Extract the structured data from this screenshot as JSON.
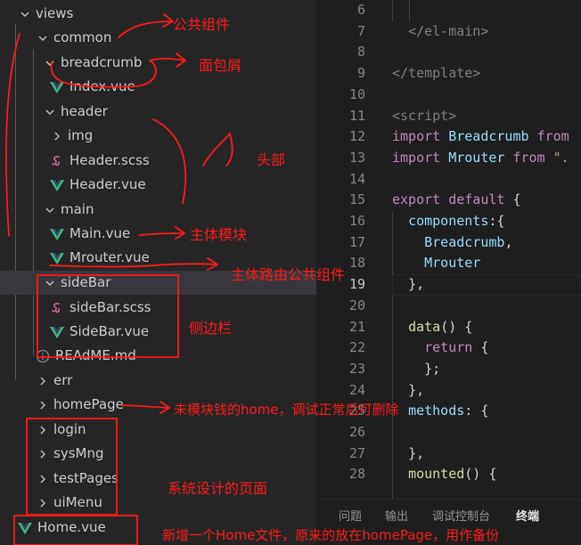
{
  "explorer": {
    "items": [
      {
        "label": "views",
        "type": "folder-open"
      },
      {
        "label": "common",
        "type": "folder-open"
      },
      {
        "label": "breadcrumb",
        "type": "folder-open"
      },
      {
        "label": "Index.vue",
        "type": "vue"
      },
      {
        "label": "header",
        "type": "folder-open"
      },
      {
        "label": "img",
        "type": "folder-closed"
      },
      {
        "label": "Header.scss",
        "type": "scss"
      },
      {
        "label": "Header.vue",
        "type": "vue"
      },
      {
        "label": "main",
        "type": "folder-open"
      },
      {
        "label": "Main.vue",
        "type": "vue"
      },
      {
        "label": "Mrouter.vue",
        "type": "vue"
      },
      {
        "label": "sideBar",
        "type": "folder-open"
      },
      {
        "label": "sideBar.scss",
        "type": "scss"
      },
      {
        "label": "SideBar.vue",
        "type": "vue"
      },
      {
        "label": "REAdME.md",
        "type": "info"
      },
      {
        "label": "err",
        "type": "folder-closed"
      },
      {
        "label": "homePage",
        "type": "folder-closed"
      },
      {
        "label": "login",
        "type": "folder-closed"
      },
      {
        "label": "sysMng",
        "type": "folder-closed"
      },
      {
        "label": "testPages",
        "type": "folder-closed"
      },
      {
        "label": "uiMenu",
        "type": "folder-closed"
      },
      {
        "label": "Home.vue",
        "type": "vue"
      }
    ]
  },
  "editor": {
    "line_numbers": [
      "6",
      "7",
      "8",
      "9",
      "10",
      "11",
      "12",
      "13",
      "14",
      "15",
      "16",
      "17",
      "18",
      "19",
      "20",
      "21",
      "22",
      "23",
      "24",
      "25",
      "26",
      "27",
      "28"
    ],
    "active_line": "19",
    "lines": [
      {
        "indent": "  ",
        "tokens": [
          {
            "t": "",
            "c": ""
          }
        ]
      },
      {
        "indent": "  ",
        "tokens": [
          {
            "t": "</el-main>",
            "c": "tg"
          }
        ]
      },
      {
        "indent": "",
        "tokens": [
          {
            "t": "",
            "c": ""
          }
        ]
      },
      {
        "indent": "",
        "tokens": [
          {
            "t": "</template>",
            "c": "tg"
          }
        ]
      },
      {
        "indent": "",
        "tokens": [
          {
            "t": "",
            "c": ""
          }
        ]
      },
      {
        "indent": "",
        "tokens": [
          {
            "t": "<script>",
            "c": "tg"
          }
        ]
      },
      {
        "indent": "",
        "tokens": [
          {
            "t": "import",
            "c": "kw2"
          },
          {
            "t": " Breadcrumb ",
            "c": "id"
          },
          {
            "t": "from",
            "c": "kw2"
          }
        ]
      },
      {
        "indent": "",
        "tokens": [
          {
            "t": "import",
            "c": "kw2"
          },
          {
            "t": " Mrouter ",
            "c": "id"
          },
          {
            "t": "from",
            "c": "kw2"
          },
          {
            "t": " \".",
            "c": "str"
          }
        ]
      },
      {
        "indent": "",
        "tokens": [
          {
            "t": "",
            "c": ""
          }
        ]
      },
      {
        "indent": "",
        "tokens": [
          {
            "t": "export",
            "c": "kw2"
          },
          {
            "t": " ",
            "c": ""
          },
          {
            "t": "default",
            "c": "kw2"
          },
          {
            "t": " {",
            "c": ""
          }
        ]
      },
      {
        "indent": "  ",
        "tokens": [
          {
            "t": "components",
            "c": "id"
          },
          {
            "t": ":{",
            "c": ""
          }
        ]
      },
      {
        "indent": "    ",
        "tokens": [
          {
            "t": "Breadcrumb",
            "c": "id"
          },
          {
            "t": ",",
            "c": ""
          }
        ]
      },
      {
        "indent": "    ",
        "tokens": [
          {
            "t": "Mrouter",
            "c": "id"
          }
        ]
      },
      {
        "indent": "  ",
        "tokens": [
          {
            "t": "},",
            "c": ""
          }
        ]
      },
      {
        "indent": "",
        "tokens": [
          {
            "t": "",
            "c": ""
          }
        ]
      },
      {
        "indent": "  ",
        "tokens": [
          {
            "t": "data",
            "c": "fn"
          },
          {
            "t": "() {",
            "c": ""
          }
        ]
      },
      {
        "indent": "    ",
        "tokens": [
          {
            "t": "return",
            "c": "kw2"
          },
          {
            "t": " {",
            "c": ""
          }
        ]
      },
      {
        "indent": "    ",
        "tokens": [
          {
            "t": "};",
            "c": ""
          }
        ]
      },
      {
        "indent": "  ",
        "tokens": [
          {
            "t": "},",
            "c": ""
          }
        ]
      },
      {
        "indent": "  ",
        "tokens": [
          {
            "t": "methods",
            "c": "id"
          },
          {
            "t": ": {",
            "c": ""
          }
        ]
      },
      {
        "indent": "",
        "tokens": [
          {
            "t": "",
            "c": ""
          }
        ]
      },
      {
        "indent": "  ",
        "tokens": [
          {
            "t": "},",
            "c": ""
          }
        ]
      },
      {
        "indent": "  ",
        "tokens": [
          {
            "t": "mounted",
            "c": "fn"
          },
          {
            "t": "() {",
            "c": ""
          }
        ]
      }
    ]
  },
  "panel": {
    "tabs": [
      "问题",
      "输出",
      "调试控制台",
      "终端"
    ],
    "active_tab": "终端"
  },
  "annotations": {
    "common": "公共组件",
    "breadcrumb": "面包屑",
    "header": "头部",
    "main_vue": "主体模块",
    "mrouter": "主体路由公共组件",
    "sidebar": "侧边栏",
    "homepage": "未模块钱的home，调试正常后可删除",
    "pages": "系统设计的页面",
    "home_vue": "新增一个Home文件，原来的放在homePage，用作备份"
  },
  "colors": {
    "annotation": "#ff1a1a",
    "vue_icon": "#41b883",
    "scss_icon": "#cd6799",
    "info_icon": "#519aba"
  }
}
